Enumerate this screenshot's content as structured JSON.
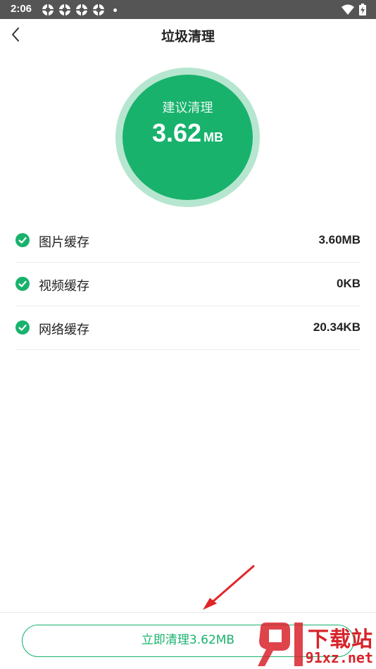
{
  "status_bar": {
    "time": "2:06",
    "notification_icons": [
      "app-icon",
      "app-icon",
      "app-icon",
      "app-icon"
    ],
    "right_icons": [
      "wifi-icon",
      "battery-charging-icon"
    ]
  },
  "header": {
    "title": "垃圾清理",
    "back_icon": "chevron-left-icon"
  },
  "summary": {
    "caption": "建议清理",
    "value": "3.62",
    "unit": "MB",
    "ring_color": "#b6e6d0",
    "fill_color": "#18b26d"
  },
  "items": [
    {
      "label": "图片缓存",
      "size": "3.60MB",
      "checked": true
    },
    {
      "label": "视频缓存",
      "size": "0KB",
      "checked": true
    },
    {
      "label": "网络缓存",
      "size": "20.34KB",
      "checked": true
    }
  ],
  "action": {
    "label": "立即清理3.62MB",
    "accent": "#18b26d"
  },
  "overlay": {
    "arrow_color": "#e0262a"
  },
  "watermark": {
    "logo_text": "91",
    "title": "下载站",
    "url": "91xz.net",
    "color": "#d8232a"
  }
}
